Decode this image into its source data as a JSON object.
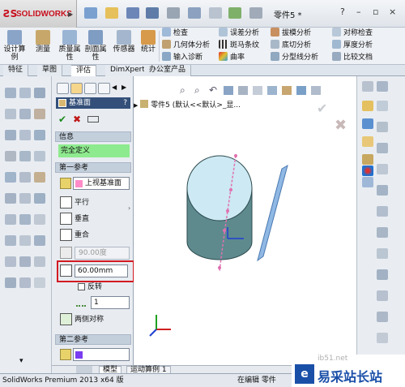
{
  "app": {
    "logo_text": "SOLIDWORKS",
    "doc_title": "零件5 *",
    "window_buttons": [
      "?",
      "–",
      "▫",
      "×"
    ]
  },
  "ribbon": {
    "big": [
      {
        "label": "设计算例"
      },
      {
        "label": "测量"
      },
      {
        "label": "质量属性"
      },
      {
        "label": "剖面属性"
      },
      {
        "label": "传感器"
      },
      {
        "label": "统计"
      }
    ],
    "col1": [
      "检查",
      "几何体分析",
      "输入诊断"
    ],
    "col2": [
      "误差分析",
      "斑马条纹",
      "曲率"
    ],
    "col3": [
      "拔模分析",
      "底切分析",
      "分型线分析"
    ],
    "col4": [
      "对称检查",
      "厚度分析",
      "比较文档"
    ]
  },
  "tabs": [
    "特征",
    "草图",
    "评估",
    "DimXpert",
    "办公室产品"
  ],
  "active_tab": "评估",
  "property_manager": {
    "title": "基准面",
    "help": "?",
    "info_header": "信息",
    "info_status": "完全定义",
    "first_ref_header": "第一参考",
    "ref_face": "上视基准面",
    "options": [
      "平行",
      "垂直",
      "重合"
    ],
    "angle_value": "90.00度",
    "distance_value": "60.00mm",
    "flip_label": "反转",
    "count_value": "1",
    "mid_plane_label": "两侧对称",
    "second_ref_header": "第二参考"
  },
  "feature_tree": {
    "root": "零件5  (默认<<默认>_显..."
  },
  "bottom_tabs": [
    "模型",
    "运动算例 1"
  ],
  "status": {
    "left": "SolidWorks Premium 2013 x64 版",
    "mid": "在编辑 零件"
  },
  "watermark": {
    "site": "ib51.net",
    "name": "易采站长站"
  },
  "colors": {
    "accent_red": "#c8101e",
    "status_green": "#8eea8e",
    "highlight_box": "#d11a22",
    "cylinder_top": "#cde9f3",
    "cylinder_side": "#5e8a8e"
  }
}
